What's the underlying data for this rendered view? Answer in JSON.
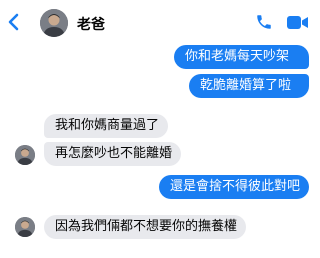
{
  "header": {
    "contact_name": "老爸",
    "back_icon": "chevron-left-icon",
    "call_icon": "phone-icon",
    "video_icon": "video-camera-icon"
  },
  "messages": [
    {
      "sender": "me",
      "text": "你和老媽每天吵架"
    },
    {
      "sender": "me",
      "text": "乾脆離婚算了啦"
    },
    {
      "sender": "dad",
      "text": "我和你媽商量過了"
    },
    {
      "sender": "dad",
      "text": "再怎麼吵也不能離婚"
    },
    {
      "sender": "me",
      "text": "還是會捨不得彼此對吧"
    },
    {
      "sender": "dad",
      "text": "因為我們倆都不想要你的撫養權"
    }
  ],
  "colors": {
    "accent": "#1a7ef2",
    "incoming_bubble": "#e8e9ed",
    "outgoing_text": "#ffffff",
    "incoming_text": "#050505"
  }
}
